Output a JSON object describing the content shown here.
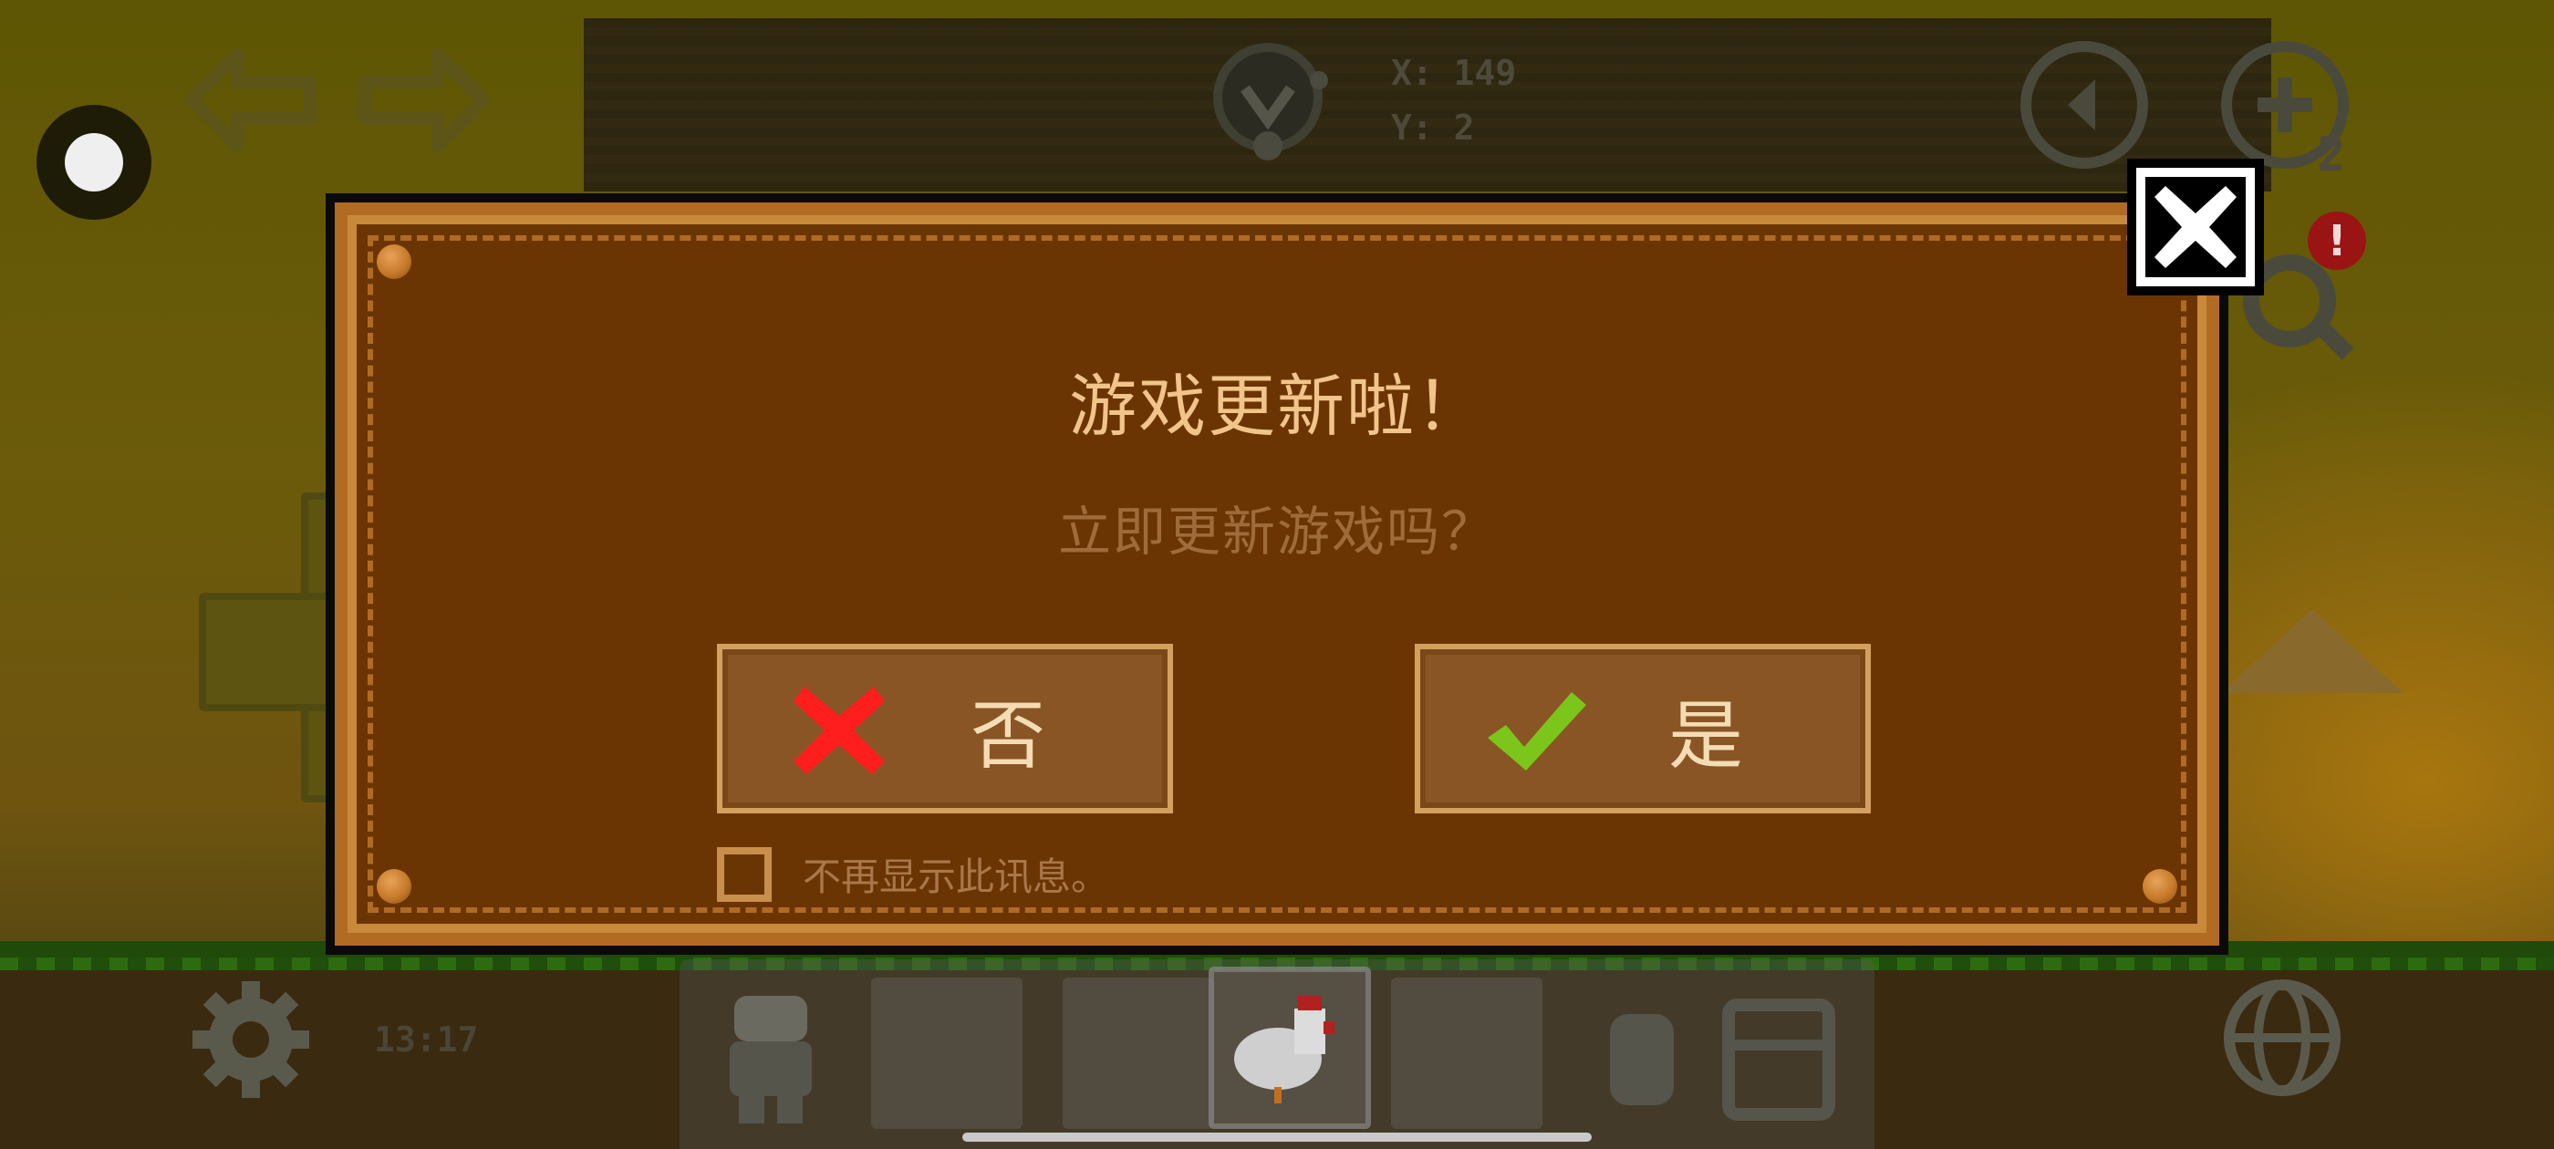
{
  "hud": {
    "coord_x": "X: 149",
    "coord_y": "Y: 2",
    "clock": "13:17",
    "zoom_badge": "2",
    "alert": "!"
  },
  "dialog": {
    "title": "游戏更新啦！",
    "subtitle": "立即更新游戏吗？",
    "no_label": "否",
    "yes_label": "是",
    "dont_show_label": "不再显示此讯息。",
    "dont_show_checked": false
  },
  "colors": {
    "dialog_bg": "#6b3503",
    "title": "#f1c58a",
    "no_icon": "#ff1e1e",
    "yes_icon": "#7cc51b"
  },
  "icons": [
    "undo-icon",
    "redo-icon",
    "lightbulb-icon",
    "back-icon",
    "zoom-in-icon",
    "search-icon",
    "close-icon",
    "gear-icon",
    "globe-icon",
    "character-icon",
    "chicken-icon",
    "cross-icon",
    "check-icon"
  ]
}
